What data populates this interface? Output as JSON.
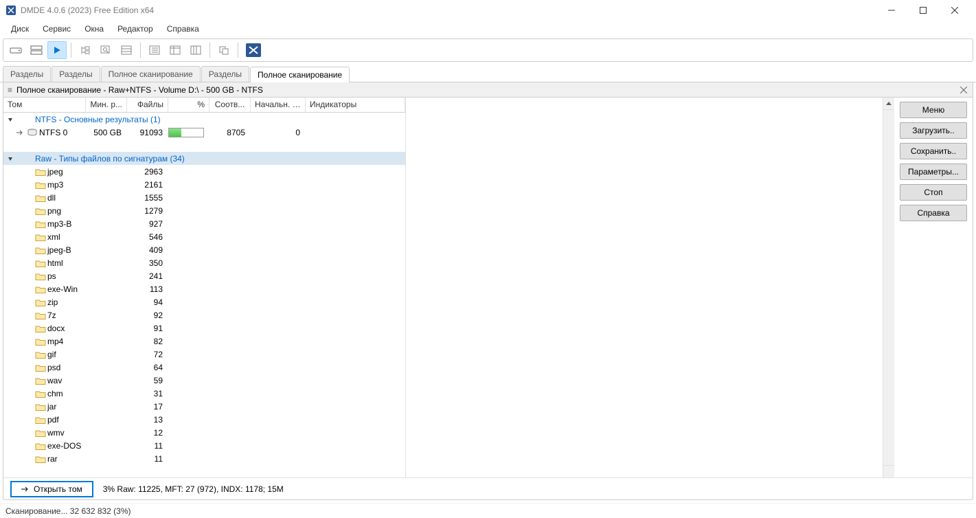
{
  "title": "DMDE 4.0.6 (2023) Free Edition x64",
  "menu": {
    "disk": "Диск",
    "service": "Сервис",
    "windows": "Окна",
    "editor": "Редактор",
    "help": "Справка"
  },
  "tabs": [
    "Разделы",
    "Разделы",
    "Полное сканирование",
    "Разделы",
    "Полное сканирование"
  ],
  "active_tab": 4,
  "panel_title": "Полное сканирование - Raw+NTFS - Volume D:\\ - 500 GB - NTFS",
  "columns": {
    "c1": "Том",
    "c2": "Мин. р...",
    "c3": "Файлы",
    "c4": "%",
    "c5": "Соотв...",
    "c6": "Начальн. LBA",
    "c7": "Индикаторы"
  },
  "ntfs_group": "NTFS - Основные результаты (1)",
  "ntfs_row": {
    "name": "NTFS 0",
    "minr": "500 GB",
    "files": "91093",
    "match": "8705",
    "lba": "0",
    "progress_pct": 35
  },
  "raw_group": "Raw - Типы файлов по сигнатурам (34)",
  "raw_items": [
    {
      "name": "jpeg",
      "files": "2963"
    },
    {
      "name": "mp3",
      "files": "2161"
    },
    {
      "name": "dll",
      "files": "1555"
    },
    {
      "name": "png",
      "files": "1279"
    },
    {
      "name": "mp3-B",
      "files": "927"
    },
    {
      "name": "xml",
      "files": "546"
    },
    {
      "name": "jpeg-B",
      "files": "409"
    },
    {
      "name": "html",
      "files": "350"
    },
    {
      "name": "ps",
      "files": "241"
    },
    {
      "name": "exe-Win",
      "files": "113"
    },
    {
      "name": "zip",
      "files": "94"
    },
    {
      "name": "7z",
      "files": "92"
    },
    {
      "name": "docx",
      "files": "91"
    },
    {
      "name": "mp4",
      "files": "82"
    },
    {
      "name": "gif",
      "files": "72"
    },
    {
      "name": "psd",
      "files": "64"
    },
    {
      "name": "wav",
      "files": "59"
    },
    {
      "name": "chm",
      "files": "31"
    },
    {
      "name": "jar",
      "files": "17"
    },
    {
      "name": "pdf",
      "files": "13"
    },
    {
      "name": "wmv",
      "files": "12"
    },
    {
      "name": "exe-DOS",
      "files": "11"
    },
    {
      "name": "rar",
      "files": "11"
    }
  ],
  "side_buttons": {
    "menu": "Меню",
    "load": "Загрузить..",
    "save": "Сохранить..",
    "params": "Параметры...",
    "stop": "Стоп",
    "help": "Справка"
  },
  "open_volume": "Открыть том",
  "bottom_status": "3% Raw: 11225, MFT: 27 (972), INDX: 1178; 15M",
  "statusbar": "Сканирование... 32 632 832 (3%)"
}
